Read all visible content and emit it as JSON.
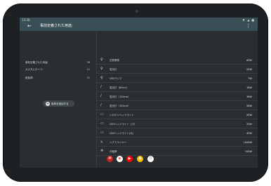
{
  "status_bar": {
    "time": "13:38",
    "icons": "▼ ◢ ■"
  },
  "app_bar": {
    "back": "←",
    "title": "事前定義された用途:",
    "menu": "⋮"
  },
  "stats": [
    {
      "label": "事前定義された用途:",
      "value": "39"
    },
    {
      "label": "カスタムロード:",
      "value": "12"
    },
    {
      "label": "総負荷:",
      "value": "71"
    }
  ],
  "add_button": {
    "icon": "+",
    "label": "負荷を追加する"
  },
  "loads": [
    {
      "icon": "♀",
      "name": "白熱電球",
      "watts": "60W"
    },
    {
      "icon": "♀",
      "name": "蛍光灯",
      "watts": "25W"
    },
    {
      "icon": "♀",
      "name": "LEDランプ",
      "watts": "7W"
    },
    {
      "icon": "/",
      "name": "蛍光灯（60cm）",
      "watts": "18W"
    },
    {
      "icon": "/",
      "name": "蛍光灯（120cm）",
      "watts": "36W"
    },
    {
      "icon": "/",
      "name": "蛍光灯（150cm）",
      "watts": "58W"
    },
    {
      "icon": "▭",
      "name": "ハロゲンヘッドライト",
      "watts": "55W"
    },
    {
      "icon": "▭",
      "name": "LEDヘッドライト（小）",
      "watts": "20W"
    },
    {
      "icon": "▭",
      "name": "LEDヘッドライト(大)",
      "watts": "40W"
    },
    {
      "icon": "ϡ",
      "name": "ヘアドライヤー",
      "watts": "1000W"
    },
    {
      "icon": "❄",
      "name": "冷蔵庫",
      "watts": "100W"
    }
  ],
  "dock": [
    {
      "icon": "gmail-icon",
      "glyph": "M",
      "color": "#ffffff"
    },
    {
      "icon": "chrome-icon",
      "glyph": "◉",
      "color": "#e8453c"
    },
    {
      "icon": "youtube-icon",
      "glyph": "▶",
      "color": "#ff0000"
    },
    {
      "icon": "photos-icon",
      "glyph": "✿",
      "color": "#ffffff"
    },
    {
      "icon": "app-drawer-icon",
      "glyph": "⠿",
      "color": "#ffffff"
    }
  ]
}
